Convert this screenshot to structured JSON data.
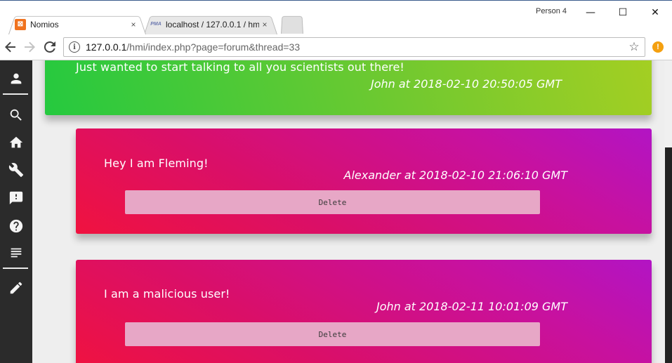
{
  "browser": {
    "profile_label": "Person 4",
    "tabs": [
      {
        "title": "Nomios",
        "favicon": "xampp-icon",
        "close": "×",
        "active": true
      },
      {
        "title": "localhost / 127.0.0.1 / hm",
        "favicon": "phpmyadmin-icon",
        "favicon_text": "PMA",
        "close": "×",
        "active": false
      }
    ],
    "window_controls": {
      "minimize": "—",
      "maximize": "☐",
      "close": "✕"
    },
    "url_host": "127.0.0.1",
    "url_path": "/hmi/index.php?page=forum&thread=33",
    "extension_badge": "!"
  },
  "sidebar": {
    "items": [
      {
        "name": "profile",
        "icon": "person-icon"
      },
      {
        "name": "search",
        "icon": "search-icon"
      },
      {
        "name": "home",
        "icon": "home-icon"
      },
      {
        "name": "settings",
        "icon": "wrench-icon"
      },
      {
        "name": "report",
        "icon": "feedback-icon"
      },
      {
        "name": "help",
        "icon": "help-icon"
      },
      {
        "name": "forum",
        "icon": "subject-icon"
      },
      {
        "name": "edit",
        "icon": "pencil-icon"
      }
    ]
  },
  "posts": [
    {
      "text": "Just wanted to start talking to all you scientists out there!",
      "meta": "John at 2018-02-10 20:50:05 GMT",
      "color_from": "#25c93f",
      "color_to": "#a5cf22"
    },
    {
      "text": "Hey I am Fleming!",
      "meta": "Alexander at 2018-02-10 21:06:10 GMT",
      "delete_label": "Delete",
      "color_from": "#f0123f",
      "color_to": "#b214c4"
    },
    {
      "text": "I am a malicious user!",
      "meta": "John at 2018-02-11 10:01:09 GMT",
      "delete_label": "Delete",
      "color_from": "#f0123f",
      "color_to": "#b214c4"
    }
  ]
}
